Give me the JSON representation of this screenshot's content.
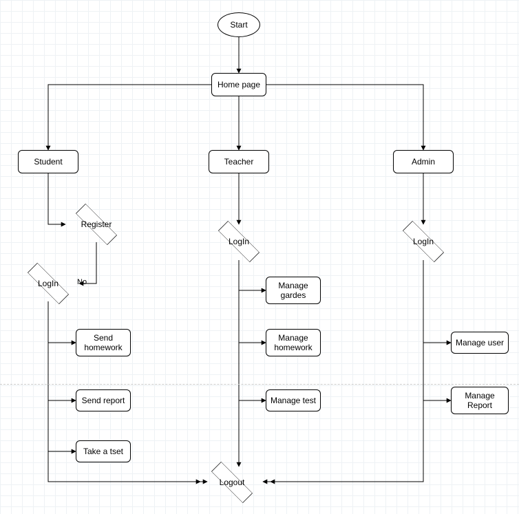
{
  "chart_data": {
    "type": "flowchart",
    "title": "",
    "nodes": [
      {
        "id": "start",
        "shape": "terminator",
        "label": "Start"
      },
      {
        "id": "home",
        "shape": "process",
        "label": "Home page"
      },
      {
        "id": "student",
        "shape": "process",
        "label": "Student"
      },
      {
        "id": "teacher",
        "shape": "process",
        "label": "Teacher"
      },
      {
        "id": "admin",
        "shape": "process",
        "label": "Admin"
      },
      {
        "id": "register",
        "shape": "decision",
        "label": "Register"
      },
      {
        "id": "login_s",
        "shape": "decision",
        "label": "LogIn"
      },
      {
        "id": "login_t",
        "shape": "decision",
        "label": "LogIn"
      },
      {
        "id": "login_a",
        "shape": "decision",
        "label": "LogIn"
      },
      {
        "id": "send_hw",
        "shape": "process",
        "label": "Send\nhomework"
      },
      {
        "id": "send_report",
        "shape": "process",
        "label": "Send report"
      },
      {
        "id": "take_test",
        "shape": "process",
        "label": "Take a tset"
      },
      {
        "id": "manage_grades",
        "shape": "process",
        "label": "Manage\ngardes"
      },
      {
        "id": "manage_hw",
        "shape": "process",
        "label": "Manage\nhomework"
      },
      {
        "id": "manage_test",
        "shape": "process",
        "label": "Manage test"
      },
      {
        "id": "manage_user",
        "shape": "process",
        "label": "Manage user"
      },
      {
        "id": "manage_report",
        "shape": "process",
        "label": "Manage\nReport"
      },
      {
        "id": "logout",
        "shape": "decision",
        "label": "Logout"
      }
    ],
    "edges": [
      {
        "from": "start",
        "to": "home"
      },
      {
        "from": "home",
        "to": "student"
      },
      {
        "from": "home",
        "to": "teacher"
      },
      {
        "from": "home",
        "to": "admin"
      },
      {
        "from": "student",
        "to": "register"
      },
      {
        "from": "register",
        "to": "login_s",
        "label": "No"
      },
      {
        "from": "login_s",
        "to": "send_hw"
      },
      {
        "from": "login_s",
        "to": "send_report"
      },
      {
        "from": "login_s",
        "to": "take_test"
      },
      {
        "from": "teacher",
        "to": "login_t"
      },
      {
        "from": "login_t",
        "to": "manage_grades"
      },
      {
        "from": "login_t",
        "to": "manage_hw"
      },
      {
        "from": "login_t",
        "to": "manage_test"
      },
      {
        "from": "admin",
        "to": "login_a"
      },
      {
        "from": "login_a",
        "to": "manage_user"
      },
      {
        "from": "login_a",
        "to": "manage_report"
      },
      {
        "from": "login_s",
        "to": "logout"
      },
      {
        "from": "login_t",
        "to": "logout"
      },
      {
        "from": "login_a",
        "to": "logout"
      }
    ]
  },
  "labels": {
    "no": "No"
  }
}
